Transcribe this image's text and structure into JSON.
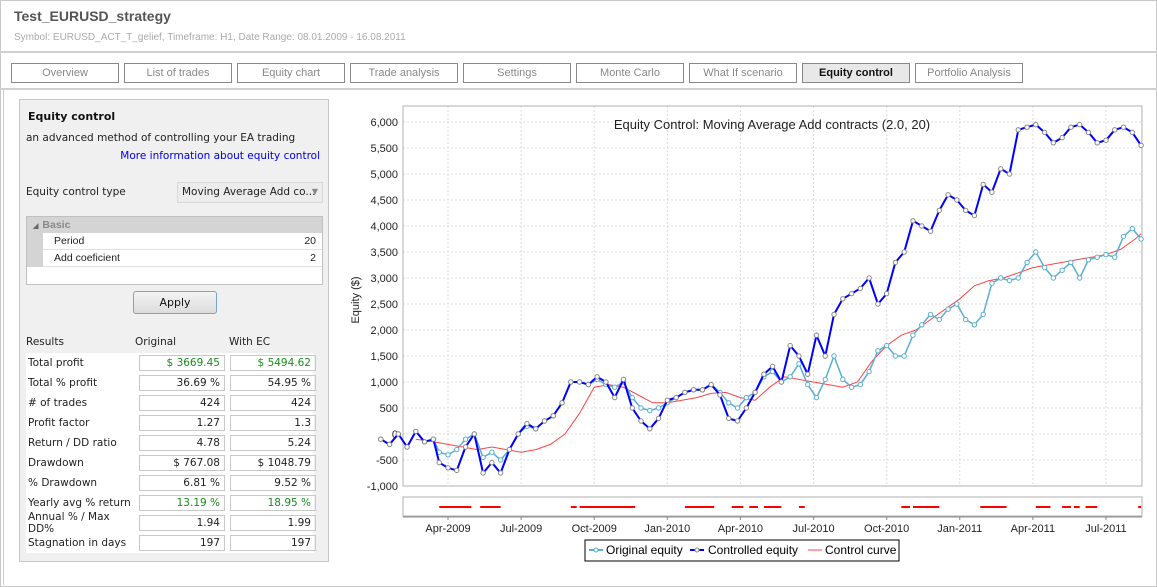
{
  "header": {
    "title": "Test_EURUSD_strategy",
    "subtitle": "Symbol: EURUSD_ACT_T_gelief, Timeframe: H1, Date Range: 08.01.2009 - 16.08.2011"
  },
  "tabs": [
    {
      "label": "Overview",
      "active": false
    },
    {
      "label": "List of trades",
      "active": false
    },
    {
      "label": "Equity chart",
      "active": false
    },
    {
      "label": "Trade analysis",
      "active": false
    },
    {
      "label": "Settings",
      "active": false
    },
    {
      "label": "Monte Carlo",
      "active": false
    },
    {
      "label": "What If scenario",
      "active": false
    },
    {
      "label": "Equity control",
      "active": true
    },
    {
      "label": "Portfolio Analysis",
      "active": false
    }
  ],
  "panel": {
    "title": "Equity control",
    "description": "an advanced method of controlling your EA trading",
    "link": "More information about equity control",
    "type_label": "Equity control type",
    "type_value": "Moving Average Add co...",
    "group_label": "Basic",
    "params": [
      {
        "name": "Period",
        "value": "20"
      },
      {
        "name": "Add coeficient",
        "value": "2"
      }
    ],
    "apply_label": "Apply",
    "results_header": {
      "label": "Results",
      "original": "Original",
      "with_ec": "With EC"
    },
    "results": [
      {
        "label": "Total profit",
        "original": "$ 3669.45",
        "with_ec": "$ 5494.62",
        "highlight": true
      },
      {
        "label": "Total % profit",
        "original": "36.69 %",
        "with_ec": "54.95 %",
        "highlight": false
      },
      {
        "label": "# of trades",
        "original": "424",
        "with_ec": "424",
        "highlight": false
      },
      {
        "label": "Profit factor",
        "original": "1.27",
        "with_ec": "1.3",
        "highlight": false
      },
      {
        "label": "Return / DD ratio",
        "original": "4.78",
        "with_ec": "5.24",
        "highlight": false
      },
      {
        "label": "Drawdown",
        "original": "$ 767.08",
        "with_ec": "$ 1048.79",
        "highlight": false
      },
      {
        "label": "% Drawdown",
        "original": "6.81 %",
        "with_ec": "9.52 %",
        "highlight": false
      },
      {
        "label": "Yearly avg % return",
        "original": "13.19 %",
        "with_ec": "18.95 %",
        "highlight": true
      },
      {
        "label": "Annual % / Max DD%",
        "original": "1.94",
        "with_ec": "1.99",
        "highlight": false
      },
      {
        "label": "Stagnation in days",
        "original": "197",
        "with_ec": "197",
        "highlight": false
      }
    ]
  },
  "colors": {
    "original": "#5aaed0",
    "controlled": "#0000ff",
    "controlled_marker": "#888888",
    "control_curve": "#ff4444",
    "green_text": "#1a8a1a",
    "link": "#0000e0"
  },
  "chart_data": {
    "type": "line",
    "title": "Equity Control: Moving Average Add contracts (2.0, 20)",
    "xlabel": "",
    "ylabel": "Equity ($)",
    "ylim": [
      -1100,
      6300
    ],
    "yticks": [
      -1000,
      -500,
      0,
      500,
      1000,
      1500,
      2000,
      2500,
      3000,
      3500,
      4000,
      4500,
      5000,
      5500,
      6000
    ],
    "ytick_labels": [
      "-1,000",
      "-500",
      "0",
      "500",
      "1,000",
      "1,500",
      "2,000",
      "2,500",
      "3,000",
      "3,500",
      "4,000",
      "4,500",
      "5,000",
      "5,500",
      "6,000"
    ],
    "xlim": [
      2009.02,
      2011.62
    ],
    "xticks": [
      2009.25,
      2009.5,
      2009.75,
      2010.0,
      2010.25,
      2010.5,
      2010.75,
      2011.0,
      2011.25,
      2011.5
    ],
    "xtick_labels": [
      "Apr-2009",
      "Jul-2009",
      "Oct-2009",
      "Jan-2010",
      "Apr-2010",
      "Jul-2010",
      "Oct-2010",
      "Jan-2011",
      "Apr-2011",
      "Jul-2011"
    ],
    "grid": true,
    "legend": {
      "placement": "bottom",
      "entries": [
        "Original equity",
        "Controlled equity",
        "Control curve"
      ]
    },
    "series": [
      {
        "name": "Original equity",
        "x": [
          2009.02,
          2009.05,
          2009.08,
          2009.11,
          2009.14,
          2009.17,
          2009.2,
          2009.22,
          2009.25,
          2009.28,
          2009.31,
          2009.34,
          2009.37,
          2009.4,
          2009.43,
          2009.46,
          2009.49,
          2009.52,
          2009.55,
          2009.58,
          2009.61,
          2009.64,
          2009.67,
          2009.7,
          2009.73,
          2009.76,
          2009.79,
          2009.82,
          2009.85,
          2009.88,
          2009.91,
          2009.94,
          2009.97,
          2010.0,
          2010.03,
          2010.06,
          2010.09,
          2010.12,
          2010.15,
          2010.18,
          2010.21,
          2010.24,
          2010.27,
          2010.3,
          2010.33,
          2010.36,
          2010.39,
          2010.42,
          2010.45,
          2010.48,
          2010.51,
          2010.54,
          2010.57,
          2010.6,
          2010.63,
          2010.66,
          2010.69,
          2010.72,
          2010.75,
          2010.78,
          2010.81,
          2010.84,
          2010.87,
          2010.9,
          2010.93,
          2010.96,
          2010.99,
          2011.02,
          2011.05,
          2011.08,
          2011.11,
          2011.14,
          2011.17,
          2011.2,
          2011.23,
          2011.26,
          2011.29,
          2011.32,
          2011.35,
          2011.38,
          2011.41,
          2011.44,
          2011.47,
          2011.5,
          2011.53,
          2011.56,
          2011.59,
          2011.62
        ],
        "y": [
          -100,
          -200,
          0,
          -250,
          50,
          -150,
          -100,
          -350,
          -400,
          -300,
          -100,
          0,
          -450,
          -350,
          -500,
          -300,
          0,
          150,
          100,
          250,
          350,
          600,
          1000,
          1000,
          950,
          1050,
          950,
          900,
          1000,
          700,
          500,
          450,
          500,
          600,
          700,
          800,
          850,
          850,
          950,
          800,
          600,
          500,
          700,
          800,
          1100,
          1200,
          1000,
          1100,
          1350,
          950,
          700,
          1050,
          1500,
          1050,
          900,
          950,
          1200,
          1600,
          1700,
          1500,
          1500,
          1900,
          2100,
          2300,
          2200,
          2400,
          2500,
          2200,
          2100,
          2300,
          2900,
          3000,
          2950,
          3000,
          3300,
          3500,
          3200,
          3000,
          3150,
          3300,
          3000,
          3350,
          3400,
          3450,
          3400,
          3800,
          3950,
          3750
        ]
      },
      {
        "name": "Controlled equity",
        "x": [
          2009.02,
          2009.05,
          2009.08,
          2009.11,
          2009.14,
          2009.17,
          2009.2,
          2009.22,
          2009.25,
          2009.28,
          2009.31,
          2009.34,
          2009.37,
          2009.4,
          2009.43,
          2009.46,
          2009.49,
          2009.52,
          2009.55,
          2009.58,
          2009.61,
          2009.64,
          2009.67,
          2009.7,
          2009.73,
          2009.76,
          2009.79,
          2009.82,
          2009.85,
          2009.88,
          2009.91,
          2009.94,
          2009.97,
          2010.0,
          2010.03,
          2010.06,
          2010.09,
          2010.12,
          2010.15,
          2010.18,
          2010.21,
          2010.24,
          2010.27,
          2010.3,
          2010.33,
          2010.36,
          2010.39,
          2010.42,
          2010.45,
          2010.48,
          2010.51,
          2010.54,
          2010.57,
          2010.6,
          2010.63,
          2010.66,
          2010.69,
          2010.72,
          2010.75,
          2010.78,
          2010.81,
          2010.84,
          2010.87,
          2010.9,
          2010.93,
          2010.96,
          2010.99,
          2011.02,
          2011.05,
          2011.08,
          2011.11,
          2011.14,
          2011.17,
          2011.2,
          2011.23,
          2011.26,
          2011.29,
          2011.32,
          2011.35,
          2011.38,
          2011.41,
          2011.44,
          2011.47,
          2011.5,
          2011.53,
          2011.56,
          2011.59,
          2011.62
        ],
        "y": [
          -100,
          -200,
          0,
          -250,
          50,
          -150,
          -100,
          -550,
          -650,
          -700,
          -250,
          0,
          -750,
          -550,
          -750,
          -300,
          0,
          200,
          100,
          250,
          350,
          600,
          1000,
          1000,
          950,
          1100,
          1000,
          700,
          1050,
          500,
          250,
          100,
          300,
          650,
          700,
          800,
          850,
          850,
          950,
          750,
          300,
          250,
          500,
          800,
          1150,
          1300,
          1000,
          1700,
          1500,
          1150,
          1900,
          1500,
          2300,
          2600,
          2700,
          2800,
          3000,
          2500,
          2700,
          3300,
          3500,
          4100,
          4000,
          3900,
          4300,
          4600,
          4500,
          4300,
          4200,
          4800,
          4650,
          5100,
          5000,
          5850,
          5900,
          5950,
          5800,
          5600,
          5700,
          5900,
          5950,
          5800,
          5600,
          5650,
          5850,
          5900,
          5800,
          5550
        ]
      },
      {
        "name": "Control curve",
        "x": [
          2009.14,
          2009.2,
          2009.25,
          2009.3,
          2009.35,
          2009.4,
          2009.45,
          2009.5,
          2009.55,
          2009.6,
          2009.65,
          2009.7,
          2009.75,
          2009.8,
          2009.85,
          2009.9,
          2009.95,
          2010.0,
          2010.05,
          2010.1,
          2010.15,
          2010.2,
          2010.25,
          2010.3,
          2010.35,
          2010.4,
          2010.45,
          2010.5,
          2010.55,
          2010.6,
          2010.65,
          2010.7,
          2010.75,
          2010.8,
          2010.85,
          2010.9,
          2010.95,
          2011.0,
          2011.05,
          2011.1,
          2011.15,
          2011.2,
          2011.25,
          2011.3,
          2011.35,
          2011.4,
          2011.45,
          2011.5,
          2011.55,
          2011.6,
          2011.62
        ],
        "y": [
          -100,
          -150,
          -200,
          -250,
          -300,
          -250,
          -300,
          -350,
          -300,
          -200,
          0,
          400,
          900,
          950,
          900,
          750,
          600,
          600,
          650,
          700,
          780,
          800,
          700,
          650,
          900,
          1100,
          1050,
          1000,
          950,
          900,
          1000,
          1400,
          1700,
          1900,
          2000,
          2200,
          2400,
          2600,
          2850,
          2950,
          3000,
          3100,
          3200,
          3250,
          3300,
          3350,
          3400,
          3450,
          3550,
          3750,
          3850
        ]
      }
    ],
    "control_active_periods": [
      [
        2009.22,
        2009.33
      ],
      [
        2009.36,
        2009.43
      ],
      [
        2009.67,
        2009.69
      ],
      [
        2009.7,
        2009.89
      ],
      [
        2010.06,
        2010.16
      ],
      [
        2010.22,
        2010.26
      ],
      [
        2010.28,
        2010.31
      ],
      [
        2010.33,
        2010.39
      ],
      [
        2010.45,
        2010.47
      ],
      [
        2010.8,
        2010.83
      ],
      [
        2010.84,
        2010.93
      ],
      [
        2011.07,
        2011.16
      ],
      [
        2011.26,
        2011.31
      ],
      [
        2011.35,
        2011.38
      ],
      [
        2011.39,
        2011.41
      ],
      [
        2011.43,
        2011.47
      ],
      [
        2011.61,
        2011.62
      ]
    ]
  }
}
